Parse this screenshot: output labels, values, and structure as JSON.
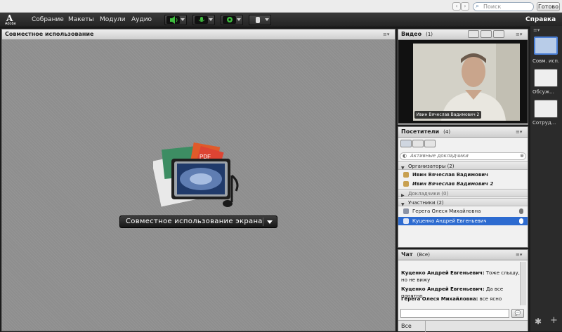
{
  "os_bar": {
    "search_placeholder": "Поиск",
    "done_label": "Готово"
  },
  "app": {
    "logo_text": "Adobe",
    "menu": [
      "Собрание",
      "Макеты",
      "Модули",
      "Аудио"
    ],
    "help_label": "Справка"
  },
  "share_pod": {
    "title": "Совместное использование",
    "share_button_label": "Совместное использование экрана"
  },
  "video_pod": {
    "title": "Видео",
    "count": "(1)",
    "caption": "Ивин Вячеслав Вадимович 2"
  },
  "attendees_pod": {
    "title": "Посетители",
    "count": "(4)",
    "filter_placeholder": "Активные докладчики",
    "hosts_group": "Организаторы (2)",
    "hosts": [
      "Ивин Вячеслав Вадимович",
      "Ивин Вячеслав Вадимович 2"
    ],
    "presenters_group": "Докладчики (0)",
    "participants_group": "Участники (2)",
    "participants": [
      "Герега Олеся Михайловна",
      "Куценко Андрей Евгеньевич"
    ]
  },
  "chat_pod": {
    "title": "Чат",
    "scope": "(Все)",
    "messages": [
      {
        "author": "Куценко Андрей Евгеньевич:",
        "text": "Тоже слышу, но не вижу"
      },
      {
        "author": "Куценко Андрей Евгеньевич:",
        "text": "Да все понятно"
      },
      {
        "author": "Герега Олеся Михайловна:",
        "text": "все ясно"
      }
    ],
    "recipient": "Все"
  },
  "layouts_bar": {
    "items": [
      "Совм. исп.",
      "Обсуж...",
      "Сотруд..."
    ]
  },
  "colors": {
    "selected_row": "#2d6bd0",
    "mic_active": "#3fbf3f"
  }
}
